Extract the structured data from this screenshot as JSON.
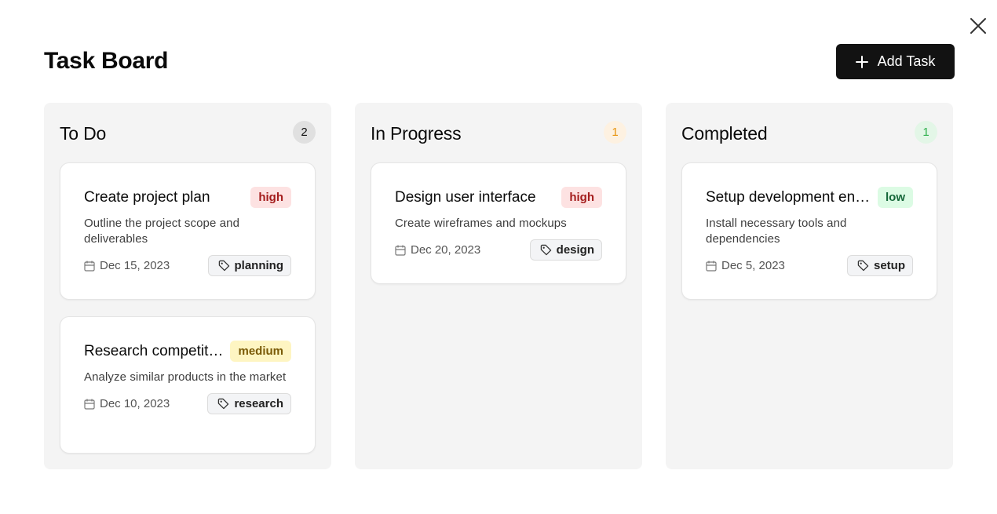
{
  "header": {
    "title": "Task Board",
    "add_task_label": "Add Task",
    "close_icon": "close-icon"
  },
  "columns": [
    {
      "title": "To Do",
      "count": "2",
      "accent": "#e0e0e0",
      "tasks": [
        {
          "title": "Create project plan",
          "priority": "high",
          "description": "Outline the project scope and deliverables",
          "date": "Dec 15, 2023",
          "tag": "planning"
        },
        {
          "title": "Research competitors",
          "priority": "medium",
          "description": "Analyze similar products in the market",
          "date": "Dec 10, 2023",
          "tag": "research"
        }
      ]
    },
    {
      "title": "In Progress",
      "count": "1",
      "accent": "#fdf1e1",
      "tasks": [
        {
          "title": "Design user interface",
          "priority": "high",
          "description": "Create wireframes and mockups",
          "date": "Dec 20, 2023",
          "tag": "design"
        }
      ]
    },
    {
      "title": "Completed",
      "count": "1",
      "accent": "#e3f6e7",
      "tasks": [
        {
          "title": "Setup development environment",
          "priority": "low",
          "description": "Install necessary tools and dependencies",
          "date": "Dec 5, 2023",
          "tag": "setup"
        }
      ]
    }
  ],
  "colors": {
    "primary_button": "#121212",
    "priority_high": "#a41c1c",
    "priority_medium": "#7a5a06",
    "priority_low": "#16683a"
  }
}
